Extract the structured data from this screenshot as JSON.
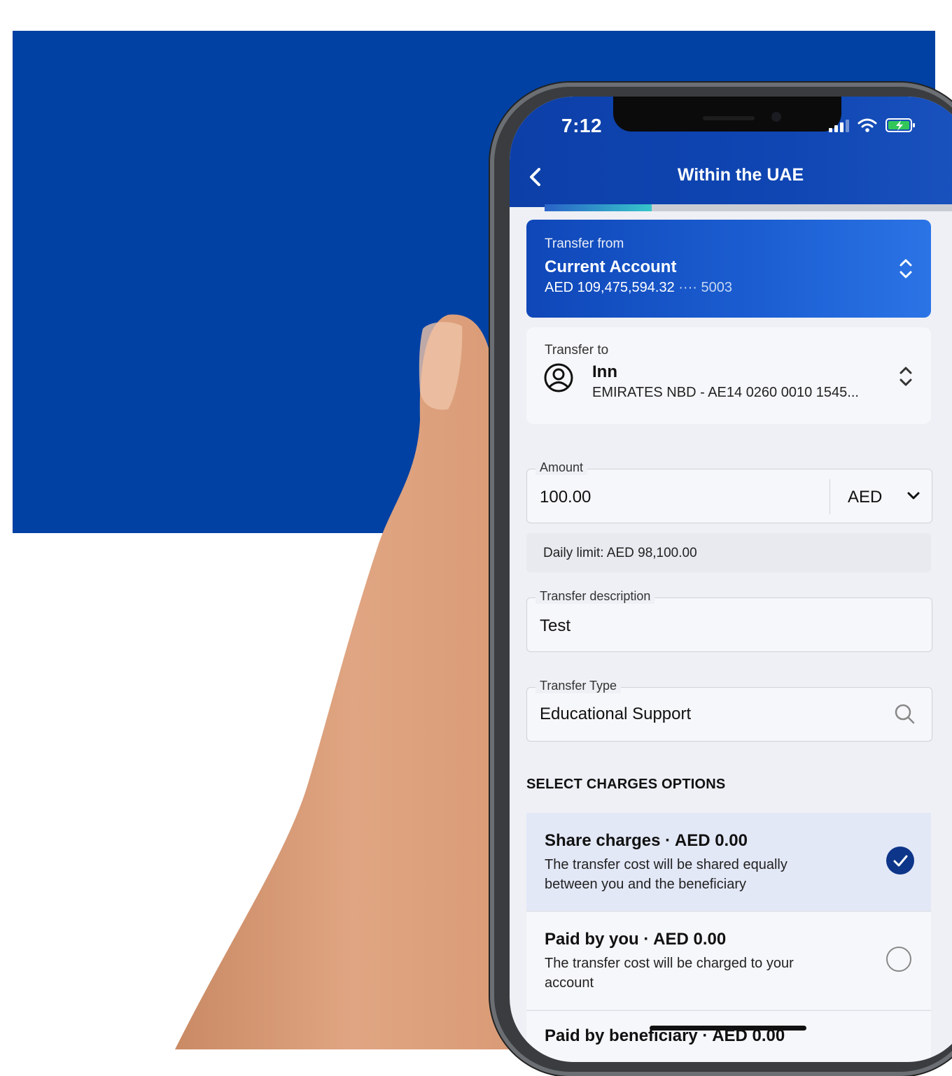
{
  "status_bar": {
    "time": "7:12"
  },
  "header": {
    "title": "Within the UAE"
  },
  "progress": {
    "fraction": 0.25
  },
  "transfer_from": {
    "label": "Transfer from",
    "account_name": "Current Account",
    "balance": "AED 109,475,594.32",
    "account_mask": "···· 5003"
  },
  "transfer_to": {
    "label": "Transfer to",
    "beneficiary_name": "Inn",
    "beneficiary_details": "EMIRATES NBD - AE14 0260 0010 1545..."
  },
  "amount": {
    "label": "Amount",
    "value": "100.00",
    "currency": "AED"
  },
  "daily_limit": "Daily limit: AED 98,100.00",
  "description": {
    "label": "Transfer description",
    "value": "Test"
  },
  "transfer_type": {
    "label": "Transfer Type",
    "value": "Educational Support"
  },
  "charges": {
    "section_title": "SELECT CHARGES OPTIONS",
    "options": [
      {
        "title": "Share charges · AED 0.00",
        "desc": "The transfer cost will be shared equally between you and the beneficiary",
        "selected": true
      },
      {
        "title": "Paid by you · AED 0.00",
        "desc": "The transfer cost will be charged to your account",
        "selected": false
      },
      {
        "title": "Paid by beneficiary · AED 0.00",
        "desc": "",
        "selected": false
      }
    ]
  },
  "colors": {
    "brand_blue": "#0041a3",
    "accent_teal": "#36c6c9",
    "selected_check": "#0d3589"
  }
}
